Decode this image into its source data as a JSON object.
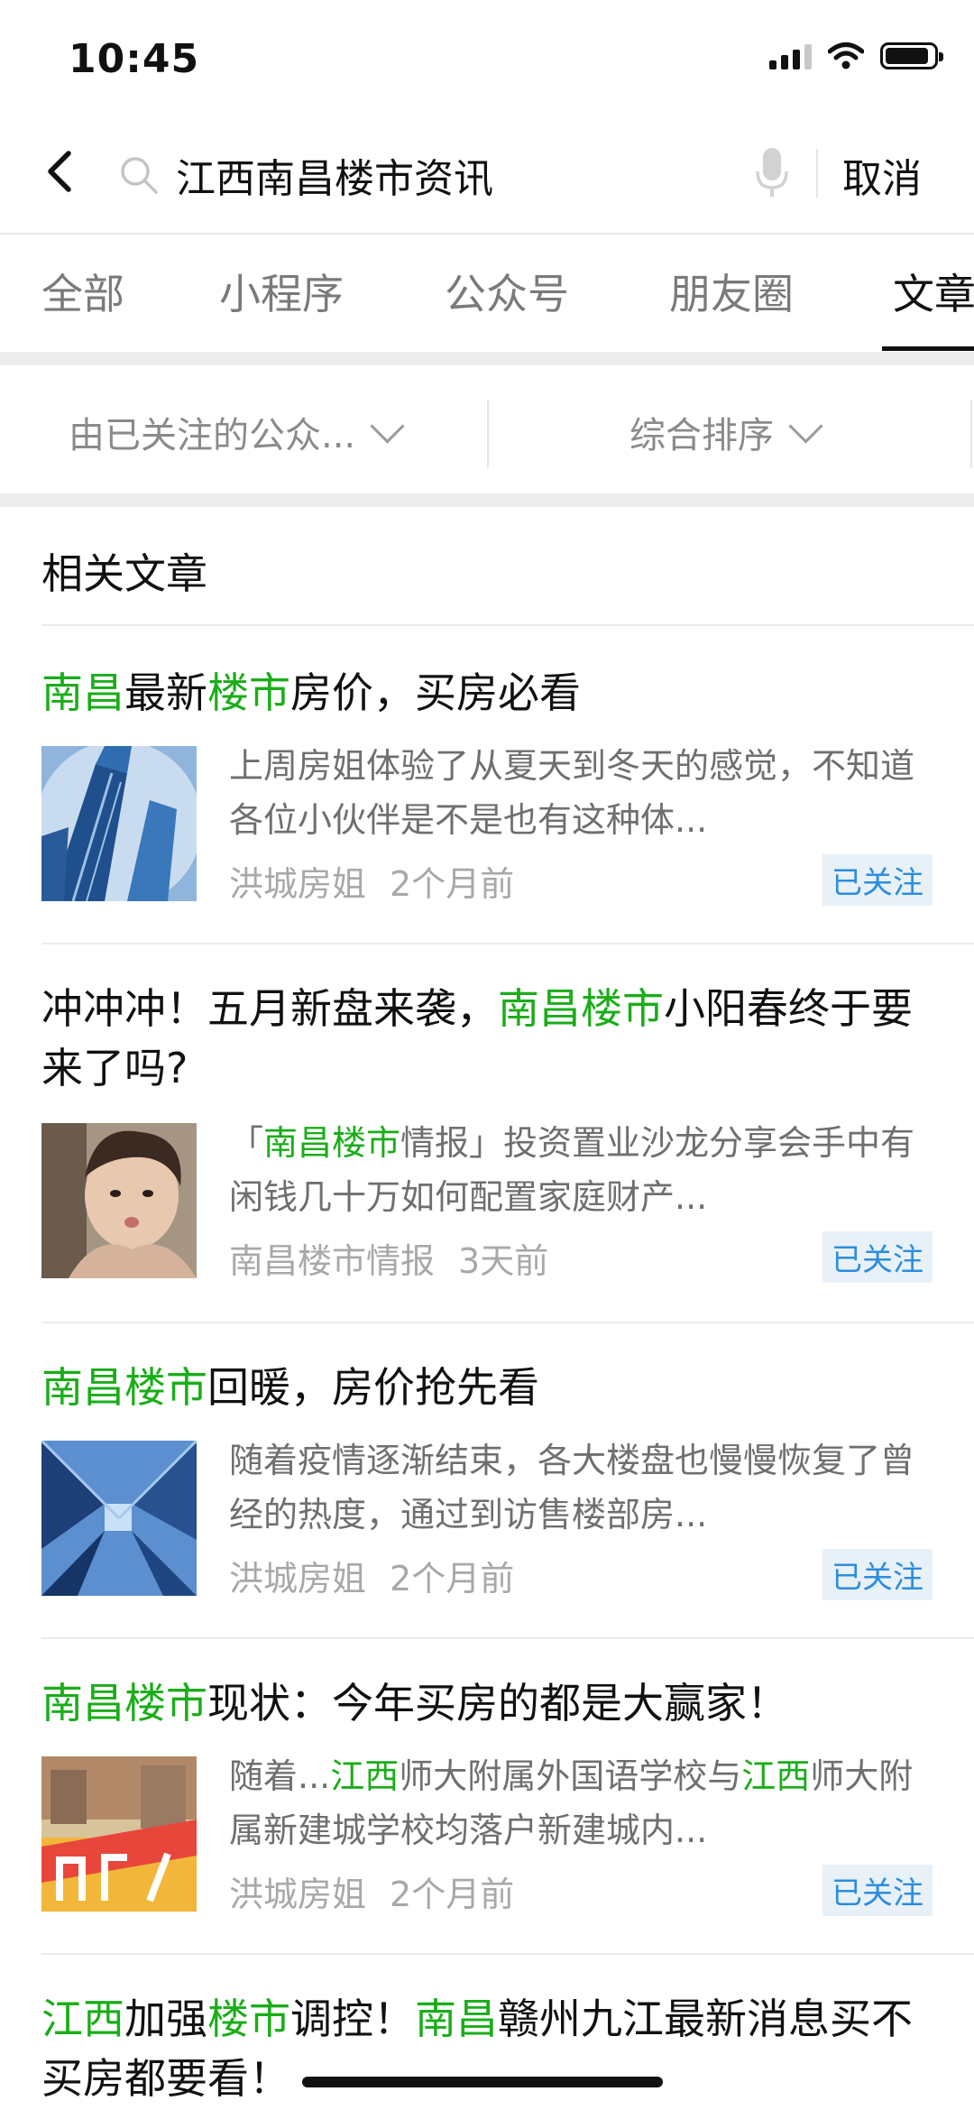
{
  "status": {
    "time": "10:45"
  },
  "search": {
    "query": "江西南昌楼市资讯",
    "cancel": "取消"
  },
  "tabs": [
    "全部",
    "小程序",
    "公众号",
    "朋友圈",
    "文章"
  ],
  "filters": {
    "source": "由已关注的公众...",
    "sort": "综合排序"
  },
  "section_title": "相关文章",
  "articles": [
    {
      "title_parts": [
        {
          "t": "南昌",
          "h": true
        },
        {
          "t": "最新",
          "h": false
        },
        {
          "t": "楼市",
          "h": true
        },
        {
          "t": "房价，买房必看",
          "h": false
        }
      ],
      "desc_parts": [
        {
          "t": "上周房姐体验了从夏天到冬天的感觉，不知道各位小伙伴是不是也有这种体...",
          "h": false
        }
      ],
      "author": "洪城房姐",
      "time": "2个月前",
      "badge": "已关注"
    },
    {
      "title_parts": [
        {
          "t": "冲冲冲！五月新盘来袭，",
          "h": false
        },
        {
          "t": "南昌楼市",
          "h": true
        },
        {
          "t": "小阳春终于要来了吗?",
          "h": false
        }
      ],
      "desc_parts": [
        {
          "t": "「",
          "h": false
        },
        {
          "t": "南昌楼市",
          "h": true
        },
        {
          "t": "情报」投资置业沙龙分享会手中有闲钱几十万如何配置家庭财产...",
          "h": false
        }
      ],
      "author": "南昌楼市情报",
      "time": "3天前",
      "badge": "已关注"
    },
    {
      "title_parts": [
        {
          "t": "南昌楼市",
          "h": true
        },
        {
          "t": "回暖，房价抢先看",
          "h": false
        }
      ],
      "desc_parts": [
        {
          "t": "随着疫情逐渐结束，各大楼盘也慢慢恢复了曾经的热度，通过到访售楼部房...",
          "h": false
        }
      ],
      "author": "洪城房姐",
      "time": "2个月前",
      "badge": "已关注"
    },
    {
      "title_parts": [
        {
          "t": "南昌楼市",
          "h": true
        },
        {
          "t": "现状：今年买房的都是大赢家！",
          "h": false
        }
      ],
      "desc_parts": [
        {
          "t": "随着...",
          "h": false
        },
        {
          "t": "江西",
          "h": true
        },
        {
          "t": "师大附属外国语学校与",
          "h": false
        },
        {
          "t": "江西",
          "h": true
        },
        {
          "t": "师大附属新建城学校均落户新建城内...",
          "h": false
        }
      ],
      "author": "洪城房姐",
      "time": "2个月前",
      "badge": "已关注"
    },
    {
      "title_parts": [
        {
          "t": "江西",
          "h": true
        },
        {
          "t": "加强",
          "h": false
        },
        {
          "t": "楼市",
          "h": true
        },
        {
          "t": "调控！",
          "h": false
        },
        {
          "t": "南昌",
          "h": true
        },
        {
          "t": "赣州九江最新消息买不买房都要看！",
          "h": false
        }
      ]
    }
  ],
  "colors": {
    "highlight": "#1aad19",
    "badge_text": "#2b8de0",
    "badge_bg": "#e9f1f8"
  }
}
